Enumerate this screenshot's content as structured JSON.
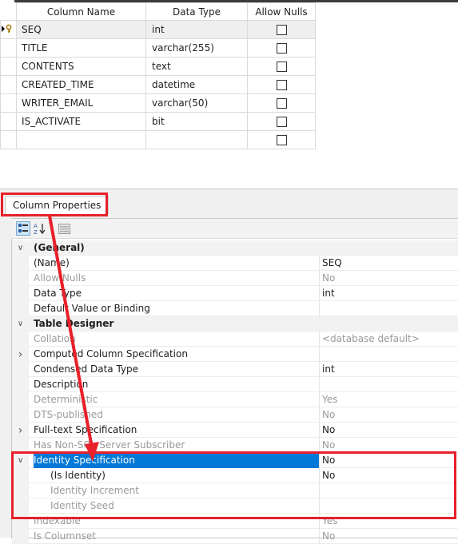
{
  "grid": {
    "headers": [
      "Column Name",
      "Data Type",
      "Allow Nulls"
    ],
    "rows": [
      {
        "name": "SEQ",
        "type": "int"
      },
      {
        "name": "TITLE",
        "type": "varchar(255)"
      },
      {
        "name": "CONTENTS",
        "type": "text"
      },
      {
        "name": "CREATED_TIME",
        "type": "datetime"
      },
      {
        "name": "WRITER_EMAIL",
        "type": "varchar(50)"
      },
      {
        "name": "IS_ACTIVATE",
        "type": "bit"
      },
      {
        "name": "",
        "type": ""
      }
    ]
  },
  "column_properties": {
    "tab_label": "Column Properties",
    "toolbar": [
      "categorized-icon",
      "alphabetical-sort-icon",
      "property-pages-icon"
    ],
    "rows": [
      {
        "name": "(General)",
        "value": "",
        "kind": "category"
      },
      {
        "name": "(Name)",
        "value": "SEQ",
        "kind": "prop"
      },
      {
        "name": "Allow Nulls",
        "value": "No",
        "kind": "dim"
      },
      {
        "name": "Data Type",
        "value": "int",
        "kind": "prop"
      },
      {
        "name": "Default Value or Binding",
        "value": "",
        "kind": "prop"
      },
      {
        "name": "Table Designer",
        "value": "",
        "kind": "category"
      },
      {
        "name": "Collation",
        "value": "<database default>",
        "kind": "dim"
      },
      {
        "name": "Computed Column Specification",
        "value": "",
        "kind": "expandable"
      },
      {
        "name": "Condensed Data Type",
        "value": "int",
        "kind": "prop"
      },
      {
        "name": "Description",
        "value": "",
        "kind": "prop"
      },
      {
        "name": "Deterministic",
        "value": "Yes",
        "kind": "dim"
      },
      {
        "name": "DTS-published",
        "value": "No",
        "kind": "dim"
      },
      {
        "name": "Full-text Specification",
        "value": "No",
        "kind": "expandable"
      },
      {
        "name": "Has Non-SQL Server Subscriber",
        "value": "No",
        "kind": "dim"
      },
      {
        "name": "Identity Specification",
        "value": "No",
        "kind": "selected"
      },
      {
        "name": "(Is Identity)",
        "value": "No",
        "kind": "sub"
      },
      {
        "name": "Identity Increment",
        "value": "",
        "kind": "subdim"
      },
      {
        "name": "Identity Seed",
        "value": "",
        "kind": "subdim"
      },
      {
        "name": "Indexable",
        "value": "Yes",
        "kind": "dim"
      },
      {
        "name": "Is Columnset",
        "value": "No",
        "kind": "dim"
      }
    ]
  },
  "colors": {
    "highlight": "#e8202a",
    "selection": "#0078d7"
  }
}
